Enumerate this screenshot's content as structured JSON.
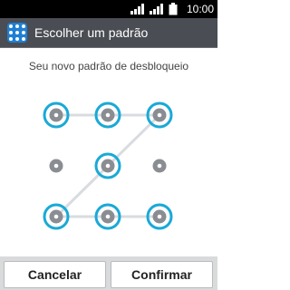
{
  "status_bar": {
    "time": "10:00",
    "icons": [
      "sim1-signal-icon",
      "sim2-signal-icon",
      "battery-icon"
    ]
  },
  "header": {
    "title": "Escolher um padrão",
    "icon": "lock-pattern-icon"
  },
  "main": {
    "instruction": "Seu novo padrão de desbloqueio",
    "pattern": {
      "grid": "3x3",
      "selected_sequence": [
        1,
        2,
        3,
        5,
        7,
        8,
        9
      ],
      "unselected_nodes": [
        4,
        6
      ],
      "line_color": "#d8dce0",
      "ring_color": "#1aa9d6",
      "node_color": "#8a8d92"
    }
  },
  "footer": {
    "cancel_label": "Cancelar",
    "confirm_label": "Confirmar"
  }
}
